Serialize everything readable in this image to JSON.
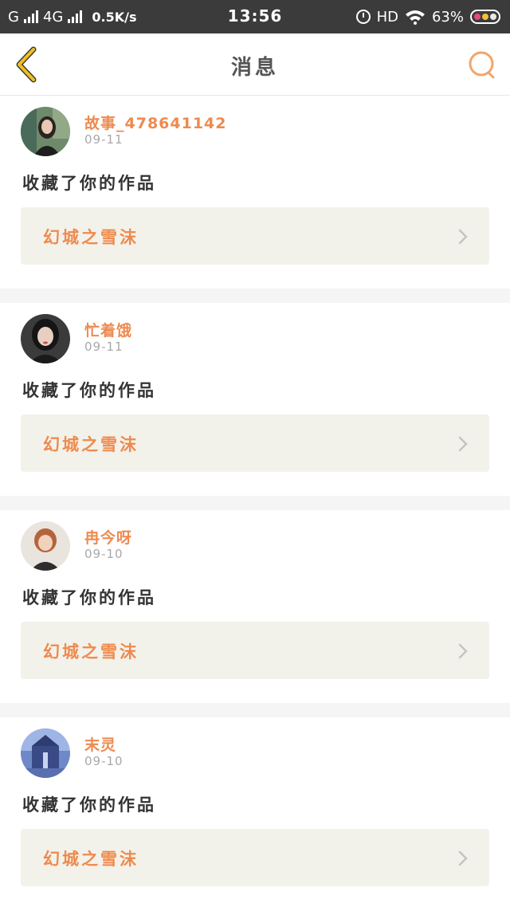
{
  "status_bar": {
    "carrier1": "G",
    "carrier2": "4G",
    "speed": "0.5K/s",
    "time": "13:56",
    "hd": "HD",
    "battery": "63%"
  },
  "nav": {
    "title": "消息",
    "back_icon": "chevron-left-icon",
    "search_icon": "search-icon"
  },
  "colors": {
    "accent": "#ee8a4f",
    "back_icon": "#f0c020",
    "card_bg": "#ffffff",
    "work_bg": "#f3f2ea"
  },
  "messages": [
    {
      "username": "故事_478641142",
      "date": "09-11",
      "action": "收藏了你的作品",
      "work_title": "幻城之雪沫"
    },
    {
      "username": "忙着饿",
      "date": "09-11",
      "action": "收藏了你的作品",
      "work_title": "幻城之雪沫"
    },
    {
      "username": "冉今呀",
      "date": "09-10",
      "action": "收藏了你的作品",
      "work_title": "幻城之雪沫"
    },
    {
      "username": "末灵",
      "date": "09-10",
      "action": "收藏了你的作品",
      "work_title": "幻城之雪沫"
    }
  ]
}
